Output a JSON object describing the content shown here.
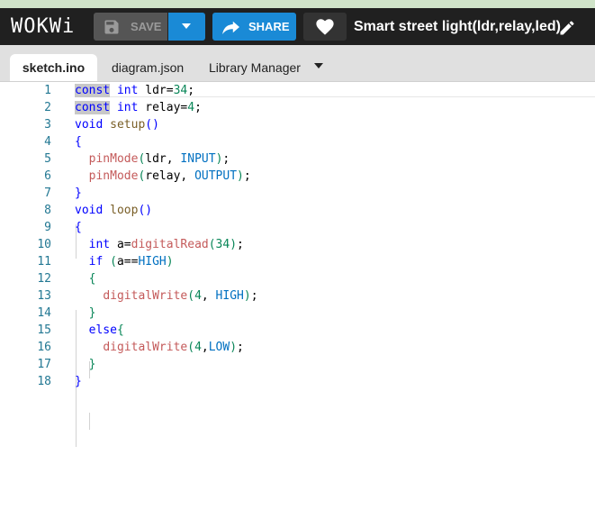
{
  "header": {
    "logo": "WOKWi",
    "save_label": "SAVE",
    "share_label": "SHARE",
    "project_title": "Smart street light(ldr,relay,led)",
    "icons": {
      "save": "floppy-disk-icon",
      "dropdown": "caret-down-icon",
      "share": "share-arrow-icon",
      "like": "heart-icon",
      "edit": "pencil-icon"
    }
  },
  "tabs": [
    {
      "label": "sketch.ino",
      "active": true
    },
    {
      "label": "diagram.json",
      "active": false
    },
    {
      "label": "Library Manager",
      "active": false
    }
  ],
  "editor": {
    "line_numbers": [
      "1",
      "2",
      "3",
      "4",
      "5",
      "6",
      "7",
      "8",
      "9",
      "10",
      "11",
      "12",
      "13",
      "14",
      "15",
      "16",
      "17",
      "18"
    ],
    "lines": [
      "const int ldr=34;",
      "const int relay=4;",
      "void setup()",
      "{",
      "  pinMode(ldr, INPUT);",
      "  pinMode(relay, OUTPUT);",
      "}",
      "void loop()",
      "{",
      "  int a=digitalRead(34);",
      "  if (a==HIGH)",
      "  {",
      "    digitalWrite(4, HIGH);",
      "  }",
      "  else{",
      "    digitalWrite(4,LOW);",
      "  }",
      "}"
    ]
  },
  "colors": {
    "header_bg": "#202020",
    "accent_blue": "#1a8ad6",
    "keyword": "#0000ff",
    "function": "#795e26",
    "number": "#098658",
    "constant": "#0070c1",
    "line_number": "#237893"
  }
}
